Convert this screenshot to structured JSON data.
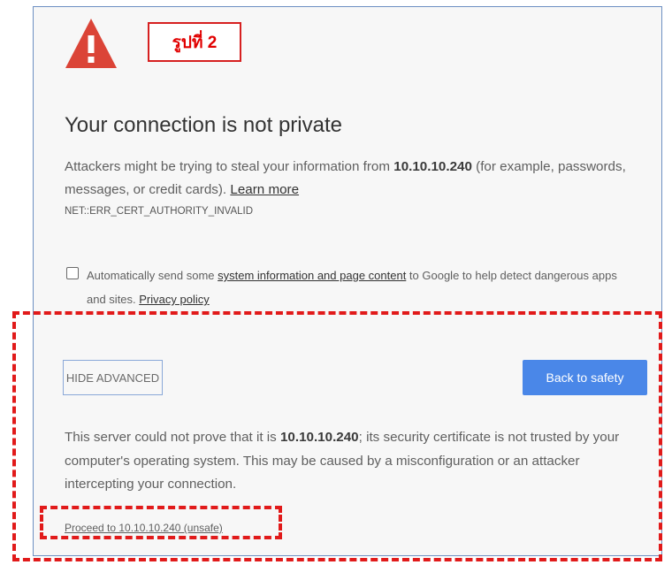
{
  "annotation": {
    "figure_label": "รูปที่ 2",
    "highlight_color": "#e11a1a"
  },
  "interstitial": {
    "icon": "warning-triangle-icon",
    "icon_color": "#db4437",
    "title": "Your connection is not private",
    "description": {
      "before_host": "Attackers might be trying to steal your information from ",
      "host": "10.10.10.240",
      "after_host": " (for example, passwords, messages, or credit cards). ",
      "learn_more": "Learn more"
    },
    "error_code": "NET::ERR_CERT_AUTHORITY_INVALID",
    "optin": {
      "checked": false,
      "before_link": "Automatically send some ",
      "link": "system information and page content",
      "after_link": " to Google to help detect dangerous apps and sites. ",
      "privacy_link": "Privacy policy"
    },
    "buttons": {
      "hide_advanced": "HIDE ADVANCED",
      "back_to_safety": "Back to safety",
      "primary_color": "#4a87e8"
    },
    "details": {
      "before_host": "This server could not prove that it is ",
      "host": "10.10.10.240",
      "after_host": "; its security certificate is not trusted by your computer's operating system. This may be caused by a misconfiguration or an attacker intercepting your connection."
    },
    "proceed_link": "Proceed to 10.10.10.240 (unsafe)"
  }
}
